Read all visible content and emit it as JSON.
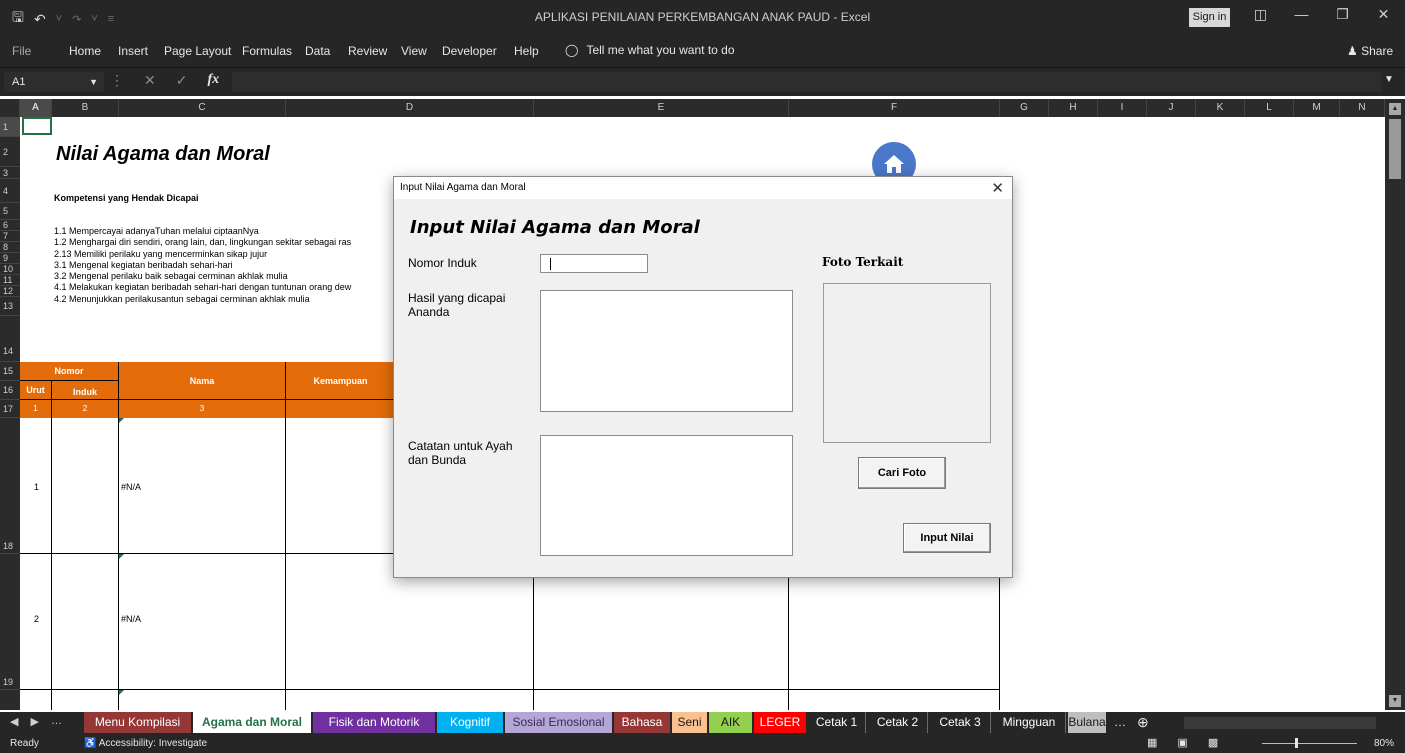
{
  "window": {
    "title": "APLIKASI PENILAIAN PERKEMBANGAN ANAK PAUD  -  Excel",
    "sign_in": "Sign in"
  },
  "ribbon": {
    "tabs": [
      "File",
      "Home",
      "Insert",
      "Page Layout",
      "Formulas",
      "Data",
      "Review",
      "View",
      "Developer",
      "Help"
    ],
    "tell_me": "Tell me what you want to do",
    "share": "Share"
  },
  "formula_bar": {
    "name_box": "A1",
    "formula": ""
  },
  "columns": [
    "A",
    "B",
    "C",
    "D",
    "E",
    "F",
    "G",
    "H",
    "I",
    "J",
    "K",
    "L",
    "M",
    "N"
  ],
  "rows": [
    "1",
    "2",
    "3",
    "4",
    "5",
    "6",
    "7",
    "8",
    "9",
    "10",
    "11",
    "12",
    "13",
    "14",
    "15",
    "16",
    "17",
    "18",
    "19"
  ],
  "sheet": {
    "title": "Nilai Agama dan Moral",
    "kompetensi_heading": "Kompetensi yang Hendak Dicapai",
    "kompetensi": [
      "1.1  Mempercayai adanyaTuhan melalui ciptaanNya",
      "1.2  Menghargai  diri sendiri, orang lain, dan,  lingkungan sekitar sebagai ras",
      "2.13 Memiliki perilaku yang mencerminkan sikap jujur",
      "3.1  Mengenal kegiatan beribadah sehari-hari",
      "3.2  Mengenal perilaku baik sebagai cerminan akhlak mulia",
      "4.1  Melakukan kegiatan beribadah sehari-hari dengan tuntunan orang dew",
      "4.2  Menunjukkan perilakusantun sebagai cerminan akhlak mulia"
    ],
    "table": {
      "header_nomor": "Nomor",
      "header_urut": "Urut",
      "header_induk": "Induk",
      "header_nama": "Nama",
      "header_kemampuan": "Kemampuan",
      "col_numbers": [
        "1",
        "2",
        "3"
      ],
      "rows": [
        {
          "urut": "1",
          "induk": "",
          "nama": "#N/A"
        },
        {
          "urut": "2",
          "induk": "",
          "nama": "#N/A"
        }
      ]
    }
  },
  "dialog": {
    "title": "Input Nilai Agama dan Moral",
    "heading": "Input Nilai Agama dan Moral",
    "nomor_induk_label": "Nomor Induk",
    "nomor_induk_value": "",
    "hasil_label_1": "Hasil yang dicapai",
    "hasil_label_2": "Ananda",
    "catatan_label_1": "Catatan untuk Ayah",
    "catatan_label_2": "dan Bunda",
    "foto_label": "Foto Terkait",
    "cari_foto": "Cari Foto",
    "input_nilai": "Input Nilai"
  },
  "sheet_tabs": [
    {
      "label": "Menu Kompilasi",
      "color": "#953735"
    },
    {
      "label": "Agama dan Moral",
      "color": "#ffffff",
      "active": true
    },
    {
      "label": "Fisik dan Motorik",
      "color": "#7030a0"
    },
    {
      "label": "Kognitif",
      "color": "#00b0f0"
    },
    {
      "label": "Sosial Emosional",
      "color": "#b4a7d6"
    },
    {
      "label": "Bahasa",
      "color": "#953735"
    },
    {
      "label": "Seni",
      "color": "#fac090"
    },
    {
      "label": "AIK",
      "color": "#92d050"
    },
    {
      "label": "LEGER",
      "color": "#ff0000"
    },
    {
      "label": "Cetak 1",
      "color": "#262626"
    },
    {
      "label": "Cetak 2",
      "color": "#262626"
    },
    {
      "label": "Cetak 3",
      "color": "#262626"
    },
    {
      "label": "Mingguan",
      "color": "#262626"
    },
    {
      "label": "Bulana",
      "color": "#bfbfbf"
    }
  ],
  "status": {
    "ready": "Ready",
    "accessibility": "Accessibility: Investigate",
    "zoom": "80%"
  }
}
